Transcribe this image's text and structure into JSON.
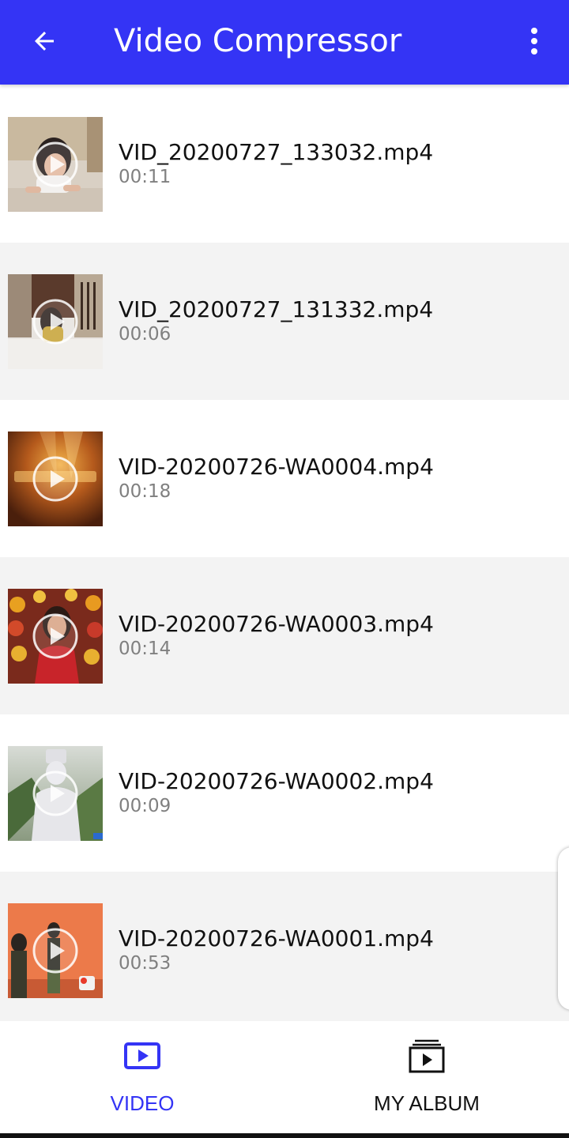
{
  "app_bar": {
    "title": "Video Compressor",
    "back_icon": "arrow-back-icon",
    "menu_icon": "more-vert-icon",
    "color": "#3434f5"
  },
  "videos": [
    {
      "name": "VID_20200727_133032.mp4",
      "duration": "00:11"
    },
    {
      "name": "VID_20200727_131332.mp4",
      "duration": "00:06"
    },
    {
      "name": "VID-20200726-WA0004.mp4",
      "duration": "00:18"
    },
    {
      "name": "VID-20200726-WA0003.mp4",
      "duration": "00:14"
    },
    {
      "name": "VID-20200726-WA0002.mp4",
      "duration": "00:09"
    },
    {
      "name": "VID-20200726-WA0001.mp4",
      "duration": "00:53"
    }
  ],
  "bottom_nav": {
    "video_label": "VIDEO",
    "album_label": "MY ALBUM",
    "active": "VIDEO",
    "active_color": "#3434f5"
  }
}
